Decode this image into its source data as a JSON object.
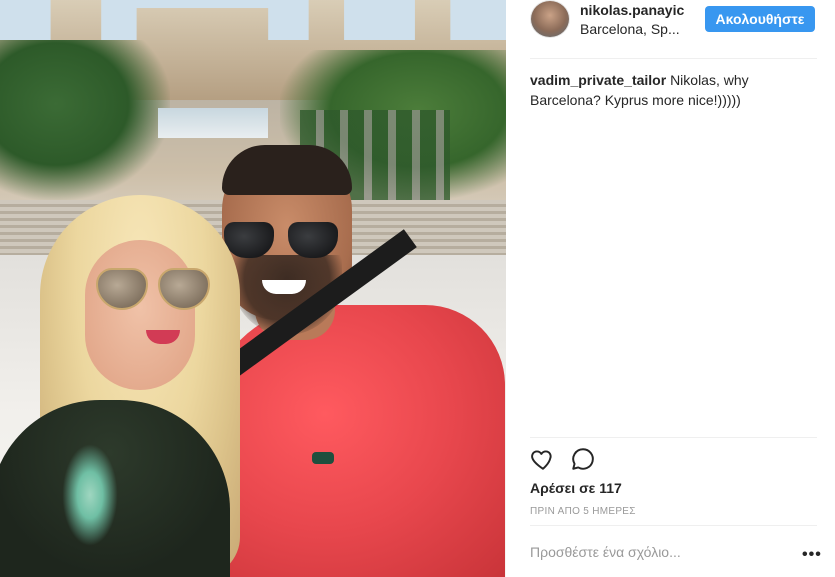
{
  "photo": {
    "alt_icon": "photo"
  },
  "post": {
    "author": {
      "username": "nikolas.panayic",
      "location": "Barcelona, Sp...",
      "avatar_icon": "avatar"
    },
    "follow_label": "Ακολουθήστε",
    "comments": [
      {
        "author": "vadim_private_tailor",
        "text": "Nikolas, why Barcelona? Kyprus more nice!)))))"
      }
    ],
    "actions": {
      "like_icon": "heart-outline-icon",
      "comment_icon": "comment-bubble-icon"
    },
    "likes_text": "Αρέσει σε 117",
    "timestamp": "ΠΡΙΝ ΑΠΟ 5 ΗΜΕΡΕΣ",
    "add_comment_placeholder": "Προσθέστε ένα σχόλιο...",
    "more_label": "•••"
  },
  "colors": {
    "follow_button": "#3897f0",
    "text": "#262626",
    "muted": "#999999",
    "divider": "#efefef"
  }
}
